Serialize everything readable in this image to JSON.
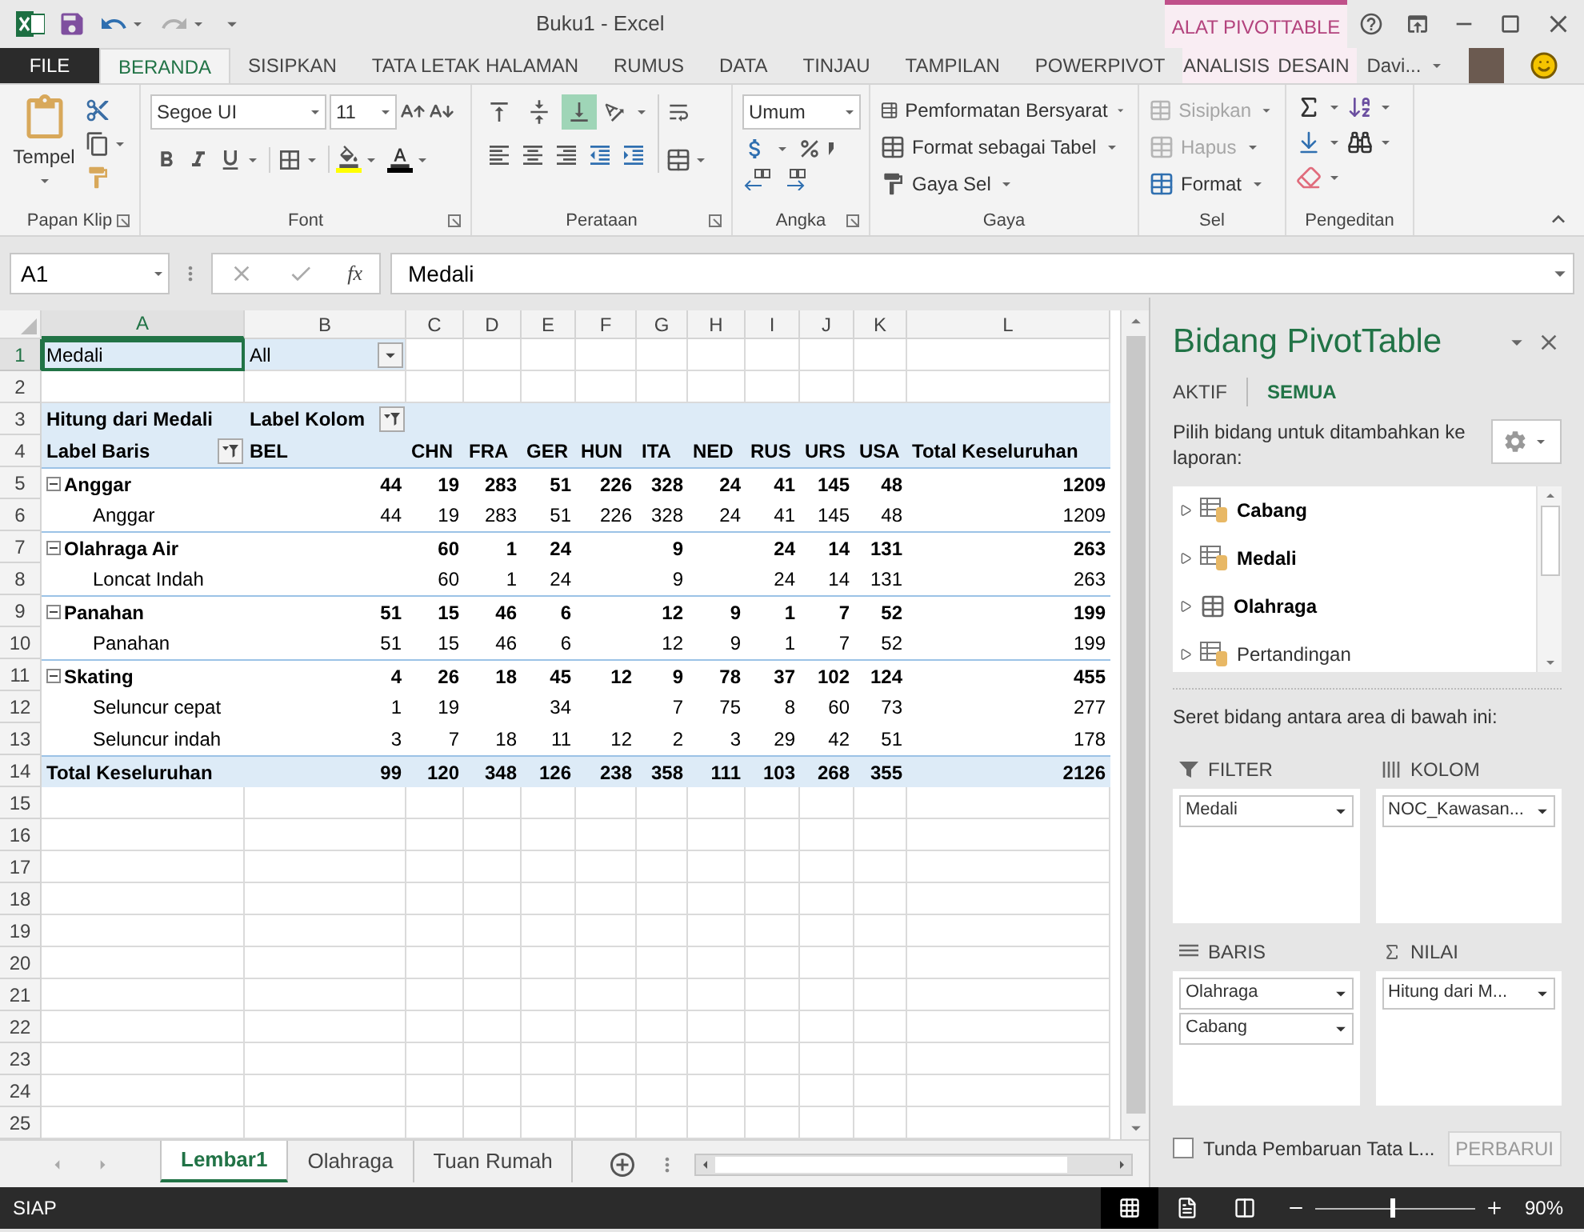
{
  "window": {
    "title": "Buku1 - Excel",
    "context_label": "ALAT PIVOTTABLE",
    "user": "Davi..."
  },
  "tabs": [
    {
      "label": "FILE",
      "kind": "file",
      "selected": false
    },
    {
      "label": "BERANDA",
      "kind": "normal",
      "selected": true
    },
    {
      "label": "SISIPKAN",
      "kind": "normal",
      "selected": false
    },
    {
      "label": "TATA LETAK HALAMAN",
      "kind": "normal",
      "selected": false
    },
    {
      "label": "RUMUS",
      "kind": "normal",
      "selected": false
    },
    {
      "label": "DATA",
      "kind": "normal",
      "selected": false
    },
    {
      "label": "TINJAU",
      "kind": "normal",
      "selected": false
    },
    {
      "label": "TAMPILAN",
      "kind": "normal",
      "selected": false
    },
    {
      "label": "POWERPIVOT",
      "kind": "normal",
      "selected": false
    },
    {
      "label": "ANALISIS",
      "kind": "context",
      "selected": false
    },
    {
      "label": "DESAIN",
      "kind": "context",
      "selected": false
    }
  ],
  "ribbon": {
    "clipboard": {
      "label": "Papan Klip",
      "paste": "Tempel"
    },
    "font": {
      "label": "Font",
      "family": "Segoe UI",
      "size": "11"
    },
    "alignment": {
      "label": "Perataan",
      "vertical": [
        {
          "selected": false
        },
        {
          "selected": false
        },
        {
          "selected": true
        }
      ]
    },
    "number": {
      "label": "Angka",
      "format": "Umum"
    },
    "styles": {
      "label": "Gaya",
      "items": [
        "Pemformatan Bersyarat",
        "Format sebagai Tabel",
        "Gaya Sel"
      ]
    },
    "cells": {
      "label": "Sel",
      "items": [
        {
          "label": "Sisipkan",
          "disabled": true
        },
        {
          "label": "Hapus",
          "disabled": true
        },
        {
          "label": "Format",
          "disabled": false
        }
      ]
    },
    "editing": {
      "label": "Pengeditan"
    }
  },
  "formula_bar": {
    "name_box": "A1",
    "function_symbol": "fx",
    "value": "Medali"
  },
  "sheet": {
    "columns": [
      {
        "label": "A",
        "selected": true
      },
      {
        "label": "B",
        "selected": false
      },
      {
        "label": "C",
        "selected": false
      },
      {
        "label": "D",
        "selected": false
      },
      {
        "label": "E",
        "selected": false
      },
      {
        "label": "F",
        "selected": false
      },
      {
        "label": "G",
        "selected": false
      },
      {
        "label": "H",
        "selected": false
      },
      {
        "label": "I",
        "selected": false
      },
      {
        "label": "J",
        "selected": false
      },
      {
        "label": "K",
        "selected": false
      },
      {
        "label": "L",
        "selected": false
      }
    ],
    "rows": [
      {
        "number": "1",
        "selected": true,
        "kind": "filter",
        "cells": [
          "Medali",
          {
            "text": "All",
            "kind": "dropdown"
          },
          null,
          null,
          null,
          null,
          null,
          null,
          null,
          null,
          null,
          null
        ]
      },
      {
        "number": "2",
        "selected": false,
        "kind": "blank"
      },
      {
        "number": "3",
        "selected": false,
        "kind": "header",
        "cells": [
          "Hitung dari Medali",
          {
            "text": "Label Kolom",
            "kind": "filter"
          },
          null,
          null,
          null,
          null,
          null,
          null,
          null,
          null,
          null,
          null
        ]
      },
      {
        "number": "4",
        "selected": false,
        "kind": "header",
        "cells": [
          {
            "text": "Label Baris",
            "kind": "filter"
          },
          "BEL",
          "CHN",
          "FRA",
          "GER",
          "HUN",
          "ITA",
          "NED",
          "RUS",
          "URS",
          "USA",
          "Total Keseluruhan"
        ]
      },
      {
        "number": "5",
        "selected": false,
        "kind": "group",
        "expanded": true,
        "cells": [
          "Anggar",
          "44",
          "19",
          "283",
          "51",
          "226",
          "328",
          "24",
          "41",
          "145",
          "48",
          "1209"
        ]
      },
      {
        "number": "6",
        "selected": false,
        "kind": "item",
        "cells": [
          "Anggar",
          "44",
          "19",
          "283",
          "51",
          "226",
          "328",
          "24",
          "41",
          "145",
          "48",
          "1209"
        ]
      },
      {
        "number": "7",
        "selected": false,
        "kind": "group",
        "expanded": true,
        "cells": [
          "Olahraga Air",
          null,
          "60",
          "1",
          "24",
          null,
          "9",
          null,
          "24",
          "14",
          "131",
          "263"
        ]
      },
      {
        "number": "8",
        "selected": false,
        "kind": "item",
        "cells": [
          "Loncat Indah",
          null,
          "60",
          "1",
          "24",
          null,
          "9",
          null,
          "24",
          "14",
          "131",
          "263"
        ]
      },
      {
        "number": "9",
        "selected": false,
        "kind": "group",
        "expanded": true,
        "cells": [
          "Panahan",
          "51",
          "15",
          "46",
          "6",
          null,
          "12",
          "9",
          "1",
          "7",
          "52",
          "199"
        ]
      },
      {
        "number": "10",
        "selected": false,
        "kind": "item",
        "cells": [
          "Panahan",
          "51",
          "15",
          "46",
          "6",
          null,
          "12",
          "9",
          "1",
          "7",
          "52",
          "199"
        ]
      },
      {
        "number": "11",
        "selected": false,
        "kind": "group",
        "expanded": true,
        "cells": [
          "Skating",
          "4",
          "26",
          "18",
          "45",
          "12",
          "9",
          "78",
          "37",
          "102",
          "124",
          "455"
        ]
      },
      {
        "number": "12",
        "selected": false,
        "kind": "item",
        "cells": [
          "Seluncur cepat",
          "1",
          "19",
          null,
          "34",
          null,
          "7",
          "75",
          "8",
          "60",
          "73",
          "277"
        ]
      },
      {
        "number": "13",
        "selected": false,
        "kind": "item",
        "cells": [
          "Seluncur indah",
          "3",
          "7",
          "18",
          "11",
          "12",
          "2",
          "3",
          "29",
          "42",
          "51",
          "178"
        ]
      },
      {
        "number": "14",
        "selected": false,
        "kind": "total",
        "cells": [
          "Total Keseluruhan",
          "99",
          "120",
          "348",
          "126",
          "238",
          "358",
          "111",
          "103",
          "268",
          "355",
          "2126"
        ]
      },
      {
        "number": "15",
        "selected": false,
        "kind": "empty"
      },
      {
        "number": "16",
        "selected": false,
        "kind": "empty"
      },
      {
        "number": "17",
        "selected": false,
        "kind": "empty"
      },
      {
        "number": "18",
        "selected": false,
        "kind": "empty"
      },
      {
        "number": "19",
        "selected": false,
        "kind": "empty"
      },
      {
        "number": "20",
        "selected": false,
        "kind": "empty"
      },
      {
        "number": "21",
        "selected": false,
        "kind": "empty"
      },
      {
        "number": "22",
        "selected": false,
        "kind": "empty"
      },
      {
        "number": "23",
        "selected": false,
        "kind": "empty"
      },
      {
        "number": "24",
        "selected": false,
        "kind": "empty"
      },
      {
        "number": "25",
        "selected": false,
        "kind": "empty"
      }
    ]
  },
  "sheet_tabs": [
    {
      "label": "Lembar1",
      "selected": true
    },
    {
      "label": "Olahraga",
      "selected": false
    },
    {
      "label": "Tuan Rumah",
      "selected": false
    }
  ],
  "pivot_pane": {
    "title": "Bidang PivotTable",
    "tabs": [
      {
        "label": "AKTIF",
        "selected": false
      },
      {
        "label": "SEMUA",
        "selected": true
      }
    ],
    "instruction": "Pilih bidang untuk ditambahkan ke laporan:",
    "fields": [
      {
        "name": "Cabang",
        "kind": "linked",
        "active": true
      },
      {
        "name": "Medali",
        "kind": "linked",
        "active": true
      },
      {
        "name": "Olahraga",
        "kind": "table",
        "active": true
      },
      {
        "name": "Pertandingan",
        "kind": "linked",
        "active": false
      }
    ],
    "drag_hint": "Seret bidang antara area di bawah ini:",
    "areas": [
      {
        "label": "FILTER",
        "kind": "filter",
        "items": [
          "Medali"
        ]
      },
      {
        "label": "KOLOM",
        "kind": "columns",
        "items": [
          "NOC_Kawasan..."
        ]
      },
      {
        "label": "BARIS",
        "kind": "rows",
        "items": [
          "Olahraga",
          "Cabang"
        ]
      },
      {
        "label": "NILAI",
        "kind": "values",
        "items": [
          "Hitung dari M..."
        ]
      }
    ],
    "defer": {
      "label": "Tunda Pembaruan Tata L...",
      "checked": false
    },
    "update_button": {
      "label": "PERBARUI",
      "disabled": true
    }
  },
  "status_bar": {
    "status": "SIAP",
    "views": [
      {
        "kind": "normal",
        "selected": true
      },
      {
        "kind": "page_layout",
        "selected": false
      },
      {
        "kind": "page_break",
        "selected": false
      }
    ],
    "zoom": {
      "level": 0.47,
      "reading": "90%"
    }
  }
}
